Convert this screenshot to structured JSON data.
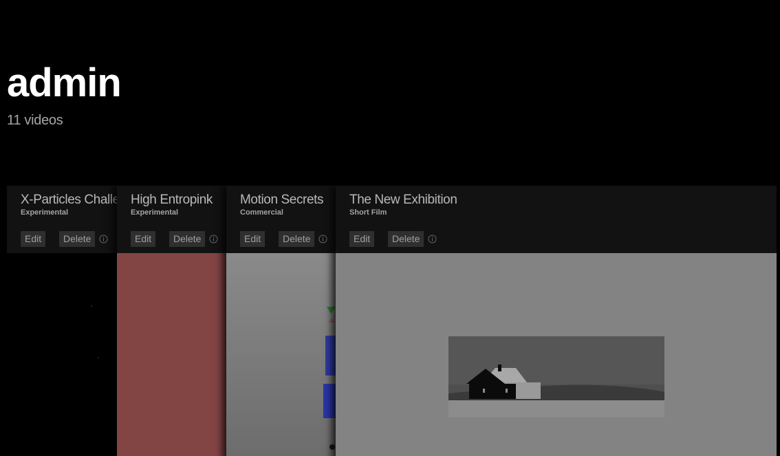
{
  "profile": {
    "username": "admin",
    "video_count": "11 videos"
  },
  "cards": [
    {
      "title": "X-Particles Challenge",
      "category": "Experimental",
      "edit_label": "Edit",
      "delete_label": "Delete",
      "thumbnail_color": "#000000"
    },
    {
      "title": "High Entropink",
      "category": "Experimental",
      "edit_label": "Edit",
      "delete_label": "Delete",
      "thumbnail_color": "#834444"
    },
    {
      "title": "Motion Secrets",
      "category": "Commercial",
      "edit_label": "Edit",
      "delete_label": "Delete",
      "thumbnail_color": "#7d7d7d"
    },
    {
      "title": "The New Exhibition",
      "category": "Short Film",
      "edit_label": "Edit",
      "delete_label": "Delete",
      "thumbnail_color": "#838383"
    }
  ],
  "icons": {
    "info": "info-icon"
  }
}
